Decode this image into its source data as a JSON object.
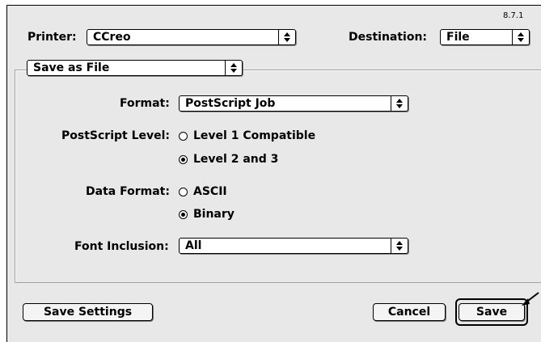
{
  "version": "8.7.1",
  "printer": {
    "label": "Printer:",
    "value": "CCreo"
  },
  "destination": {
    "label": "Destination:",
    "value": "File"
  },
  "section_popup": {
    "value": "Save as File"
  },
  "format": {
    "label": "Format:",
    "value": "PostScript Job"
  },
  "postscript_level": {
    "label": "PostScript Level:",
    "options": [
      {
        "label": "Level 1 Compatible",
        "selected": false
      },
      {
        "label": "Level 2 and 3",
        "selected": true
      }
    ]
  },
  "data_format": {
    "label": "Data Format:",
    "options": [
      {
        "label": "ASCII",
        "selected": false
      },
      {
        "label": "Binary",
        "selected": true
      }
    ]
  },
  "font_inclusion": {
    "label": "Font Inclusion:",
    "value": "All"
  },
  "buttons": {
    "save_settings": "Save Settings",
    "cancel": "Cancel",
    "save": "Save"
  },
  "icons": {
    "popup_arrow": "updown-arrows-icon",
    "cursor": "arrow-cursor-icon"
  }
}
